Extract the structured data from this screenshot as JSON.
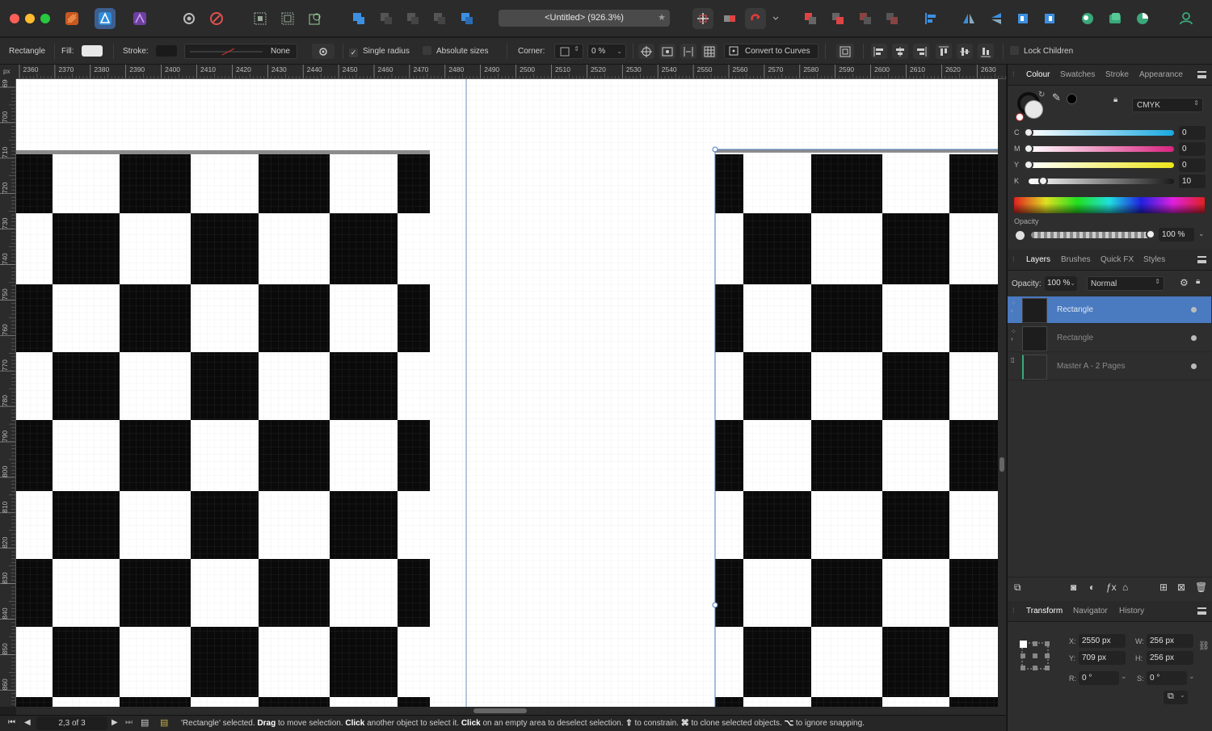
{
  "window": {
    "title": "<Untitled> (926.3%)"
  },
  "colors": {
    "accent": "#4a7abf",
    "checker_dark": "#0a0a0a",
    "selection": "#4a7abf"
  },
  "context_bar": {
    "tool_name": "Rectangle",
    "fill_label": "Fill:",
    "stroke_label": "Stroke:",
    "stroke_style": "None",
    "single_radius": "Single radius",
    "absolute_sizes": "Absolute sizes",
    "corner_label": "Corner:",
    "corner_value": "0 %",
    "convert_to_curves": "Convert to Curves",
    "lock_children": "Lock Children"
  },
  "rulers": {
    "unit": "px",
    "top_labels": [
      "2360",
      "2370",
      "2380",
      "2390",
      "2400",
      "2410",
      "2420",
      "2430",
      "2440",
      "2450",
      "2460",
      "2470",
      "2480",
      "2490",
      "2500",
      "2510",
      "2520",
      "2530",
      "2540",
      "2550",
      "2560",
      "2570",
      "2580",
      "2590",
      "2600",
      "2610",
      "2620",
      "2630"
    ],
    "left_labels": [
      "690",
      "700",
      "710",
      "720",
      "730",
      "740",
      "750",
      "760",
      "770",
      "780",
      "790",
      "800",
      "810",
      "820",
      "830",
      "840",
      "850",
      "860"
    ]
  },
  "colour_panel": {
    "tabs": [
      "Colour",
      "Swatches",
      "Stroke",
      "Appearance"
    ],
    "model": "CMYK",
    "channels": [
      {
        "label": "C",
        "value": "0",
        "level": 0
      },
      {
        "label": "M",
        "value": "0",
        "level": 0
      },
      {
        "label": "Y",
        "value": "0",
        "level": 0
      },
      {
        "label": "K",
        "value": "10",
        "level": 0.1
      }
    ],
    "opacity_label": "Opacity",
    "opacity_value": "100 %",
    "opacity_level": 1
  },
  "layers_panel": {
    "tabs": [
      "Layers",
      "Brushes",
      "Quick FX",
      "Styles"
    ],
    "opacity_label": "Opacity:",
    "opacity_value": "100 %",
    "blend_mode": "Normal",
    "layers": [
      {
        "name": "Rectangle",
        "selected": true
      },
      {
        "name": "Rectangle",
        "selected": false
      },
      {
        "name": "Master A - 2 Pages",
        "selected": false
      }
    ]
  },
  "transform_panel": {
    "tabs": [
      "Transform",
      "Navigator",
      "History"
    ],
    "x_label": "X:",
    "x": "2550 px",
    "y_label": "Y:",
    "y": "709 px",
    "w_label": "W:",
    "w": "256 px",
    "h_label": "H:",
    "h": "256 px",
    "r_label": "R:",
    "r": "0 °",
    "s_label": "S:",
    "s": "0 °"
  },
  "status_bar": {
    "page_indicator": "2,3 of 3",
    "message_parts": [
      {
        "text": "'Rectangle' selected. ",
        "bold": false
      },
      {
        "text": "Drag",
        "bold": true
      },
      {
        "text": " to move selection. ",
        "bold": false
      },
      {
        "text": "Click",
        "bold": true
      },
      {
        "text": " another object to select it. ",
        "bold": false
      },
      {
        "text": "Click",
        "bold": true
      },
      {
        "text": " on an empty area to deselect selection. ",
        "bold": false
      },
      {
        "text": "⇧",
        "bold": true
      },
      {
        "text": " to constrain. ",
        "bold": false
      },
      {
        "text": "⌘",
        "bold": true
      },
      {
        "text": " to clone selected objects. ",
        "bold": false
      },
      {
        "text": "⌥",
        "bold": true
      },
      {
        "text": " to ignore snapping.",
        "bold": false
      }
    ]
  }
}
